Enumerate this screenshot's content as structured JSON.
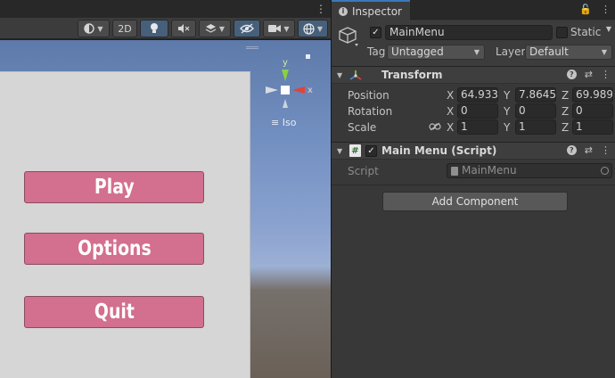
{
  "scene": {
    "toolbar": {
      "mode_2d_label": "2D"
    },
    "menu_buttons": [
      {
        "label": "Play"
      },
      {
        "label": "Options"
      },
      {
        "label": "Quit"
      }
    ],
    "gizmo": {
      "y_label": "y",
      "x_label": "x",
      "projection_label": "Iso"
    }
  },
  "inspector": {
    "tab_label": "Inspector",
    "object": {
      "name": "MainMenu",
      "static_label": "Static",
      "tag_label": "Tag",
      "tag_value": "Untagged",
      "layer_label": "Layer",
      "layer_value": "Default"
    },
    "transform": {
      "title": "Transform",
      "position_label": "Position",
      "rotation_label": "Rotation",
      "scale_label": "Scale",
      "axis_x": "X",
      "axis_y": "Y",
      "axis_z": "Z",
      "position": {
        "x": "64.9331",
        "y": "7.86455",
        "z": "69.9897"
      },
      "rotation": {
        "x": "0",
        "y": "0",
        "z": "0"
      },
      "scale": {
        "x": "1",
        "y": "1",
        "z": "1"
      }
    },
    "script_component": {
      "title": "Main Menu (Script)",
      "script_label": "Script",
      "script_value": "MainMenu"
    },
    "add_component_label": "Add Component"
  }
}
